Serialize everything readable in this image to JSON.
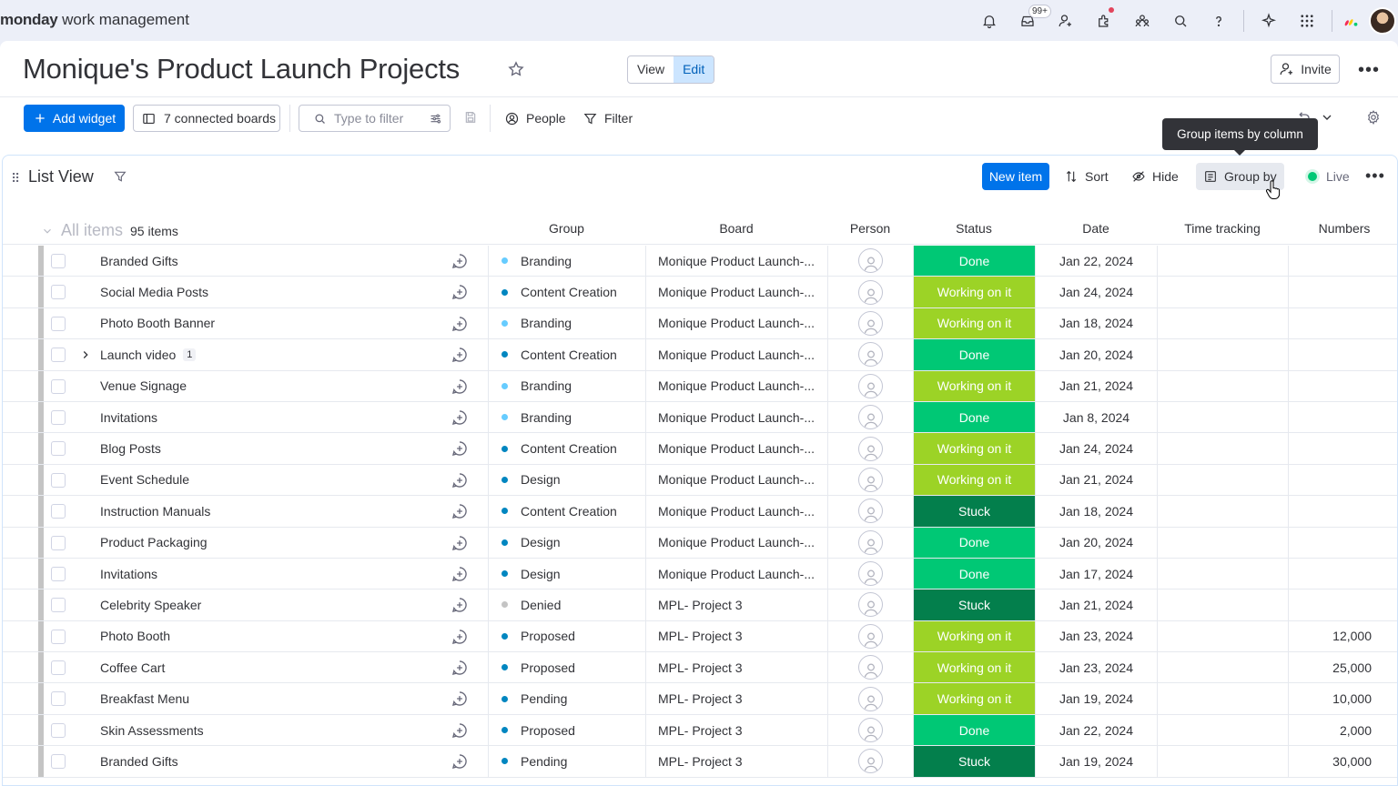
{
  "app": {
    "brand_bold": "monday",
    "brand_rest": " work management",
    "notification_badge": "99+"
  },
  "header": {
    "title": "Monique's Product Launch Projects",
    "view_label": "View",
    "edit_label": "Edit",
    "invite_label": "Invite"
  },
  "toolbar": {
    "add_widget_label": "Add widget",
    "connected_boards_label": "7 connected boards",
    "filter_placeholder": "Type to filter",
    "people_label": "People",
    "filter_label": "Filter"
  },
  "tooltip": {
    "text": "Group items by column"
  },
  "widget": {
    "title": "List View",
    "new_item_label": "New item",
    "sort_label": "Sort",
    "hide_label": "Hide",
    "group_by_label": "Group by",
    "live_label": "Live"
  },
  "table": {
    "all_items_label": "All items",
    "items_count": "95 items",
    "columns": {
      "group": "Group",
      "board": "Board",
      "person": "Person",
      "status": "Status",
      "date": "Date",
      "time_tracking": "Time tracking",
      "numbers": "Numbers"
    },
    "status_colors": {
      "Done": "#00c875",
      "Working on it": "#9cd326",
      "Stuck": "#037f4c"
    },
    "rows": [
      {
        "name": "Branded Gifts",
        "group": "Branding",
        "group_color": "#66ccff",
        "board": "Monique Product Launch-...",
        "status": "Done",
        "date": "Jan 22, 2024",
        "numbers": ""
      },
      {
        "name": "Social Media Posts",
        "group": "Content Creation",
        "group_color": "#0086c0",
        "board": "Monique Product Launch-...",
        "status": "Working on it",
        "date": "Jan 24, 2024",
        "numbers": ""
      },
      {
        "name": "Photo Booth Banner",
        "group": "Branding",
        "group_color": "#66ccff",
        "board": "Monique Product Launch-...",
        "status": "Working on it",
        "date": "Jan 18, 2024",
        "numbers": ""
      },
      {
        "name": "Launch video",
        "subitems": "1",
        "group": "Content Creation",
        "group_color": "#0086c0",
        "board": "Monique Product Launch-...",
        "status": "Done",
        "date": "Jan 20, 2024",
        "numbers": ""
      },
      {
        "name": "Venue Signage",
        "group": "Branding",
        "group_color": "#66ccff",
        "board": "Monique Product Launch-...",
        "status": "Working on it",
        "date": "Jan 21, 2024",
        "numbers": ""
      },
      {
        "name": "Invitations",
        "group": "Branding",
        "group_color": "#66ccff",
        "board": "Monique Product Launch-...",
        "status": "Done",
        "date": "Jan 8, 2024",
        "numbers": ""
      },
      {
        "name": "Blog Posts",
        "group": "Content Creation",
        "group_color": "#0086c0",
        "board": "Monique Product Launch-...",
        "status": "Working on it",
        "date": "Jan 24, 2024",
        "numbers": ""
      },
      {
        "name": "Event Schedule",
        "group": "Design",
        "group_color": "#0086c0",
        "board": "Monique Product Launch-...",
        "status": "Working on it",
        "date": "Jan 21, 2024",
        "numbers": ""
      },
      {
        "name": "Instruction Manuals",
        "group": "Content Creation",
        "group_color": "#0086c0",
        "board": "Monique Product Launch-...",
        "status": "Stuck",
        "date": "Jan 18, 2024",
        "numbers": ""
      },
      {
        "name": "Product Packaging",
        "group": "Design",
        "group_color": "#0086c0",
        "board": "Monique Product Launch-...",
        "status": "Done",
        "date": "Jan 20, 2024",
        "numbers": ""
      },
      {
        "name": "Invitations",
        "group": "Design",
        "group_color": "#0086c0",
        "board": "Monique Product Launch-...",
        "status": "Done",
        "date": "Jan 17, 2024",
        "numbers": ""
      },
      {
        "name": "Celebrity Speaker",
        "group": "Denied",
        "group_color": "#c4c4c4",
        "board": "MPL- Project 3",
        "status": "Stuck",
        "date": "Jan 21, 2024",
        "numbers": ""
      },
      {
        "name": "Photo Booth",
        "group": "Proposed",
        "group_color": "#0086c0",
        "board": "MPL- Project 3",
        "status": "Working on it",
        "date": "Jan 23, 2024",
        "numbers": "12,000"
      },
      {
        "name": "Coffee Cart",
        "group": "Proposed",
        "group_color": "#0086c0",
        "board": "MPL- Project 3",
        "status": "Working on it",
        "date": "Jan 23, 2024",
        "numbers": "25,000"
      },
      {
        "name": "Breakfast Menu",
        "group": "Pending",
        "group_color": "#0086c0",
        "board": "MPL- Project 3",
        "status": "Working on it",
        "date": "Jan 19, 2024",
        "numbers": "10,000"
      },
      {
        "name": "Skin Assessments",
        "group": "Proposed",
        "group_color": "#0086c0",
        "board": "MPL- Project 3",
        "status": "Done",
        "date": "Jan 22, 2024",
        "numbers": "2,000"
      },
      {
        "name": "Branded Gifts",
        "group": "Pending",
        "group_color": "#0086c0",
        "board": "MPL- Project 3",
        "status": "Stuck",
        "date": "Jan 19, 2024",
        "numbers": "30,000"
      }
    ]
  }
}
